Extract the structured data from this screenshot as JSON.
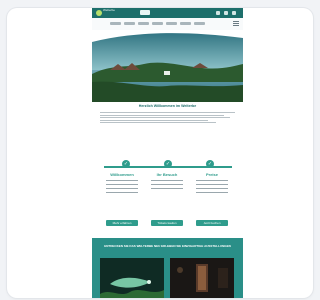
{
  "page": {
    "welcome_title": "Herzlich Willkommen im Welterbe",
    "columns": [
      {
        "title": "Willkommen",
        "cta": "Mehr erfahren"
      },
      {
        "title": "Ihr Besuch",
        "cta": "Tickets kaufen"
      },
      {
        "title": "Preise",
        "cta": "Jetzt buchen"
      }
    ],
    "banner_title": "ENTDECKEN SIE DAS WELTERBE NEU ERLEBEN SIE EINZIGARTIGE AUSSTELLUNGEN"
  },
  "colors": {
    "primary": "#1d6f6b",
    "accent": "#2f9c8c",
    "banner": "#2a8f88"
  },
  "icons": {
    "logo": "logo-icon",
    "search": "search-icon",
    "menu": "menu-icon"
  }
}
